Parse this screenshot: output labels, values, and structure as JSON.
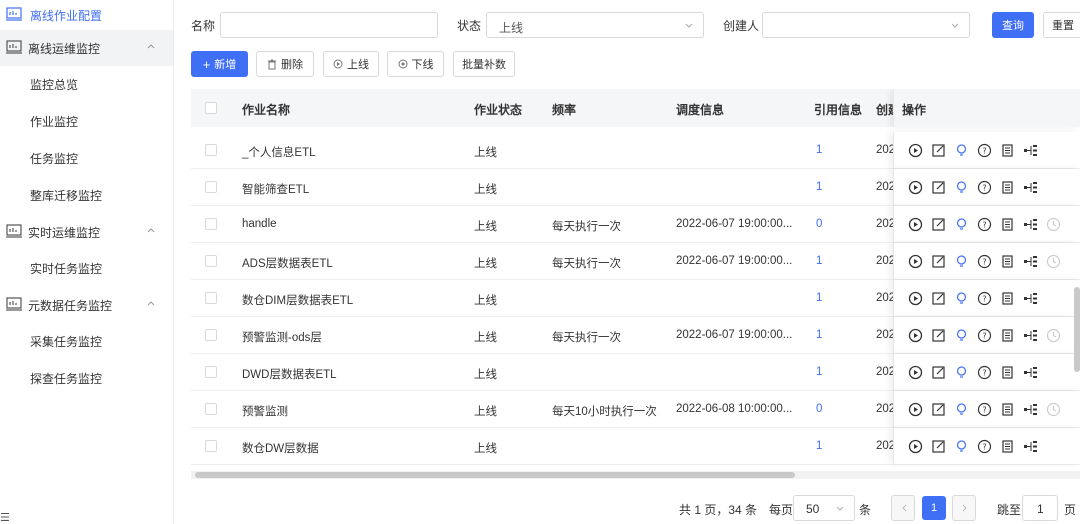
{
  "sidebar": {
    "top_item": "离线作业配置",
    "groups": [
      {
        "label": "离线运维监控",
        "items": [
          "监控总览",
          "作业监控",
          "任务监控",
          "整库迁移监控"
        ]
      },
      {
        "label": "实时运维监控",
        "items": [
          "实时任务监控"
        ]
      },
      {
        "label": "元数据任务监控",
        "items": [
          "采集任务监控",
          "探查任务监控"
        ]
      }
    ]
  },
  "filters": {
    "name_label": "名称",
    "status_label": "状态",
    "status_value": "上线",
    "creator_label": "创建人",
    "query_button": "查询",
    "reset_button": "重置"
  },
  "toolbar": {
    "add": "新增",
    "delete": "删除",
    "online": "上线",
    "offline": "下线",
    "batch": "批量补数"
  },
  "table": {
    "headers": [
      "作业名称",
      "作业状态",
      "频率",
      "调度信息",
      "引用信息",
      "创建",
      "操作"
    ],
    "rows": [
      {
        "name": "_个人信息ETL",
        "status": "上线",
        "freq": "",
        "schedule": "",
        "ref": "1",
        "created": "202"
      },
      {
        "name": "智能筛查ETL",
        "status": "上线",
        "freq": "",
        "schedule": "",
        "ref": "1",
        "created": "202"
      },
      {
        "name": "handle",
        "status": "上线",
        "freq": "每天执行一次",
        "schedule": "2022-06-07 19:00:00...",
        "ref": "0",
        "created": "202"
      },
      {
        "name": "ADS层数据表ETL",
        "status": "上线",
        "freq": "每天执行一次",
        "schedule": "2022-06-07 19:00:00...",
        "ref": "1",
        "created": "202"
      },
      {
        "name": "数仓DIM层数据表ETL",
        "status": "上线",
        "freq": "",
        "schedule": "",
        "ref": "1",
        "created": "202"
      },
      {
        "name": "预警监测-ods层",
        "status": "上线",
        "freq": "每天执行一次",
        "schedule": "2022-06-07 19:00:00...",
        "ref": "1",
        "created": "202"
      },
      {
        "name": "DWD层数据表ETL",
        "status": "上线",
        "freq": "",
        "schedule": "",
        "ref": "1",
        "created": "202"
      },
      {
        "name": "预警监测",
        "status": "上线",
        "freq": "每天10小时执行一次",
        "schedule": "2022-06-08 10:00:00...",
        "ref": "0",
        "created": "202"
      },
      {
        "name": "数仓DW层数据",
        "status": "上线",
        "freq": "",
        "schedule": "",
        "ref": "1",
        "created": "202"
      }
    ]
  },
  "pagination": {
    "summary": "共 1 页，34 条",
    "per_page_label": "每页",
    "per_page_value": "50",
    "per_page_unit": "条",
    "current_page": "1",
    "jump_label": "跳至",
    "jump_value": "1",
    "jump_unit": "页"
  },
  "colors": {
    "accent": "#3f6ff5"
  }
}
